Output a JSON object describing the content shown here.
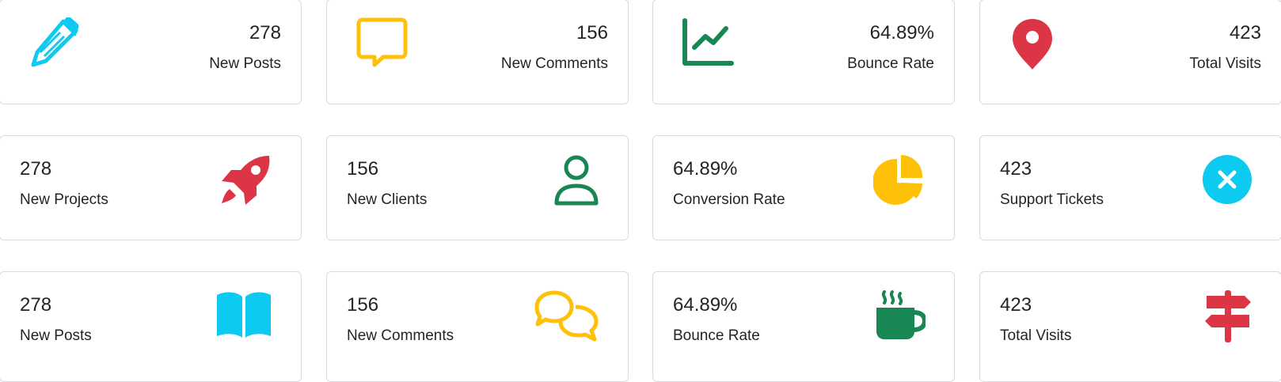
{
  "colors": {
    "info": "#0dcaf0",
    "warning": "#ffc107",
    "success": "#198754",
    "danger": "#dc3545"
  },
  "cards": [
    {
      "value": "278",
      "label": "New Posts",
      "icon": "pencil-icon",
      "color": "#0dcaf0"
    },
    {
      "value": "156",
      "label": "New Comments",
      "icon": "chat-bubble-icon",
      "color": "#ffc107"
    },
    {
      "value": "64.89%",
      "label": "Bounce Rate",
      "icon": "graph-up-icon",
      "color": "#198754"
    },
    {
      "value": "423",
      "label": "Total Visits",
      "icon": "map-pin-icon",
      "color": "#dc3545"
    },
    {
      "value": "278",
      "label": "New Projects",
      "icon": "rocket-icon",
      "color": "#dc3545"
    },
    {
      "value": "156",
      "label": "New Clients",
      "icon": "person-icon",
      "color": "#198754"
    },
    {
      "value": "64.89%",
      "label": "Conversion Rate",
      "icon": "pie-chart-icon",
      "color": "#ffc107"
    },
    {
      "value": "423",
      "label": "Support Tickets",
      "icon": "x-circle-icon",
      "color": "#0dcaf0"
    },
    {
      "value": "278",
      "label": "New Posts",
      "icon": "book-icon",
      "color": "#0dcaf0"
    },
    {
      "value": "156",
      "label": "New Comments",
      "icon": "chat-bubbles-icon",
      "color": "#ffc107"
    },
    {
      "value": "64.89%",
      "label": "Bounce Rate",
      "icon": "coffee-cup-icon",
      "color": "#198754"
    },
    {
      "value": "423",
      "label": "Total Visits",
      "icon": "signpost-icon",
      "color": "#dc3545"
    }
  ]
}
